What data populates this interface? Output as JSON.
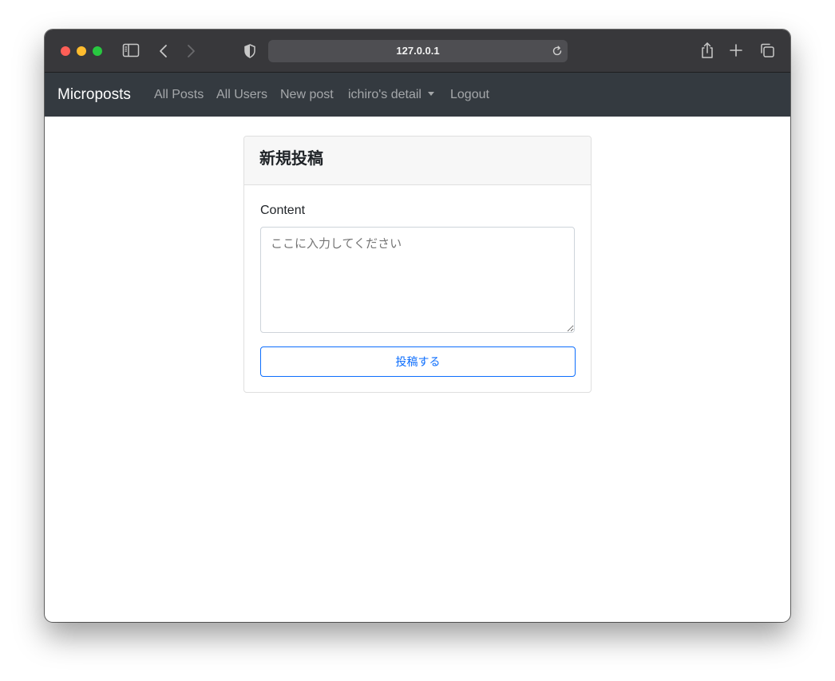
{
  "browser": {
    "url": "127.0.0.1"
  },
  "navbar": {
    "brand": "Microposts",
    "links": [
      {
        "label": "All Posts"
      },
      {
        "label": "All Users"
      },
      {
        "label": "New post"
      },
      {
        "label": "ichiro's detail"
      },
      {
        "label": "Logout"
      }
    ]
  },
  "form": {
    "title": "新規投稿",
    "content_label": "Content",
    "content_placeholder": "ここに入力してください",
    "content_value": "",
    "submit_label": "投稿する"
  },
  "colors": {
    "navbar_bg": "#343a40",
    "accent": "#0d6efd",
    "toolbar_bg": "#38383b"
  },
  "icons": [
    "sidebar-icon",
    "back-icon",
    "forward-icon",
    "shield-icon",
    "reload-icon",
    "share-icon",
    "new-tab-icon",
    "tabs-overview-icon",
    "dropdown-caret-icon"
  ]
}
